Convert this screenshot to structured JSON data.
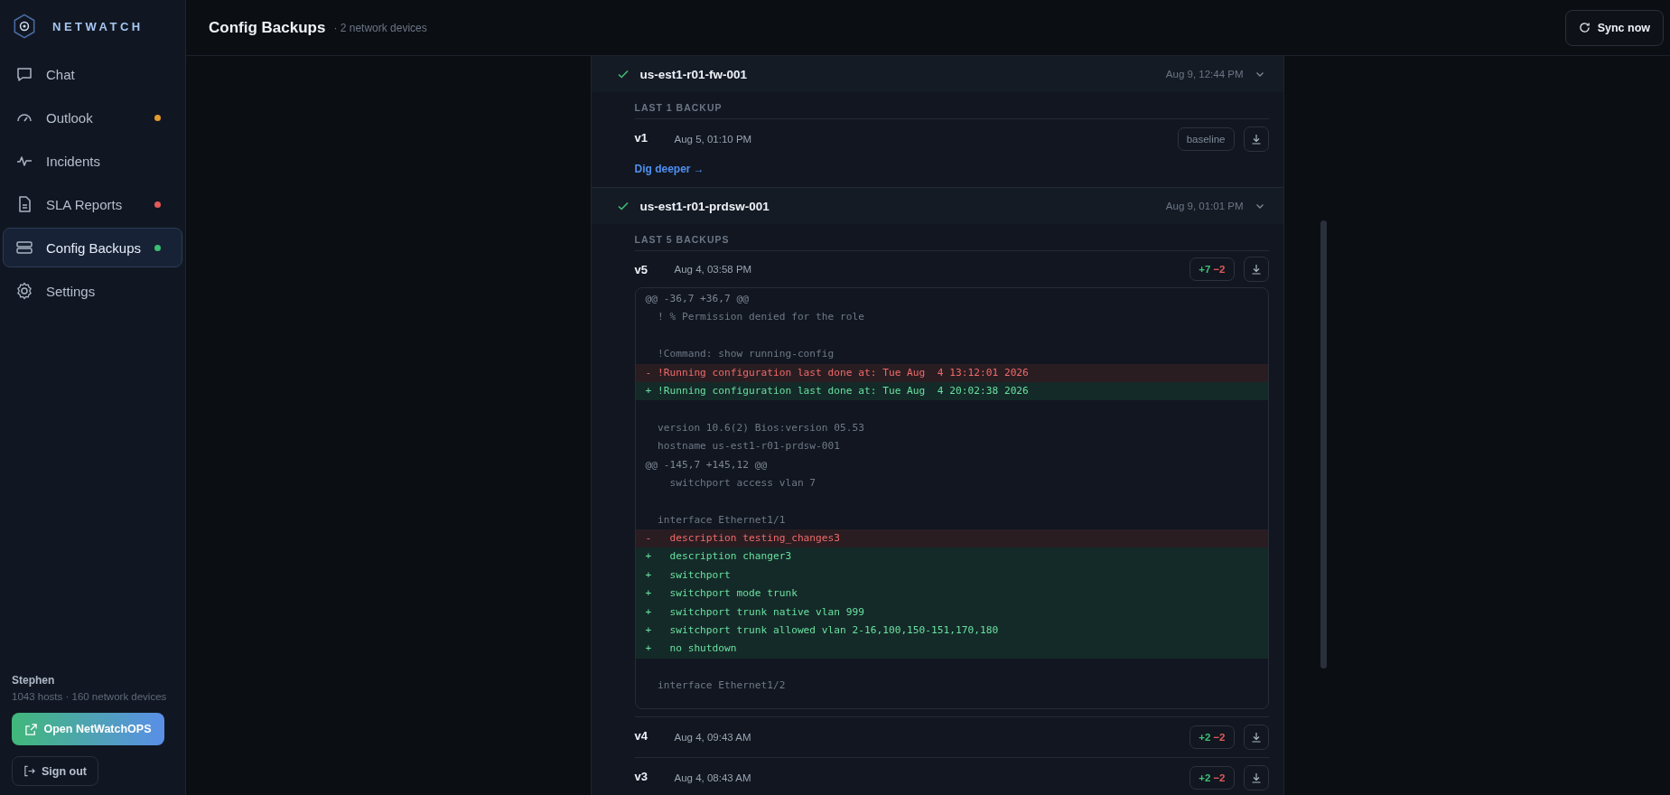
{
  "brand": {
    "name": "NETWATCH"
  },
  "nav": {
    "items": [
      {
        "label": "Chat",
        "selected": false
      },
      {
        "label": "Outlook",
        "selected": false,
        "color": "#e39b2f"
      },
      {
        "label": "Incidents",
        "selected": false
      },
      {
        "label": "SLA Reports",
        "selected": false,
        "color": "#e35a5a"
      },
      {
        "label": "Config Backups",
        "selected": true,
        "color": "#3bbf73"
      },
      {
        "label": "Settings",
        "selected": false
      }
    ]
  },
  "user": {
    "name": "Stephen",
    "summary": "1043 hosts · 160 network devices",
    "open_button": "Open NetWatchOPS",
    "signout_button": "Sign out"
  },
  "header": {
    "title": "Config Backups",
    "subtitle": "· 2 network devices",
    "sync_button": "Sync now"
  },
  "devices": [
    {
      "name": "us-est1-r01-fw-001",
      "time": "Aug 9, 12:44 PM",
      "expanded": true,
      "section": "LAST 1 BACKUP",
      "link": "Dig deeper →",
      "versions": [
        {
          "label": "v1",
          "time": "Aug 5, 01:10 PM",
          "badge": {
            "kind": "baseline",
            "label": "baseline"
          }
        }
      ]
    },
    {
      "name": "us-est1-r01-prdsw-001",
      "time": "Aug 9, 01:01 PM",
      "expanded": true,
      "section": "LAST 5 BACKUPS",
      "versions": [
        {
          "label": "v5",
          "time": "Aug 4, 03:58 PM",
          "badge": {
            "kind": "diff",
            "added": "+7",
            "removed": "−2"
          },
          "diff": [
            {
              "kind": "hunk",
              "text": "@@ -36,7 +36,7 @@"
            },
            {
              "kind": "context",
              "text": "  ! % Permission denied for the role"
            },
            {
              "kind": "blank"
            },
            {
              "kind": "context",
              "text": "  !Command: show running-config"
            },
            {
              "kind": "del",
              "text": "- !Running configuration last done at: Tue Aug  4 13:12:01 2026"
            },
            {
              "kind": "add",
              "text": "+ !Running configuration last done at: Tue Aug  4 20:02:38 2026"
            },
            {
              "kind": "blank"
            },
            {
              "kind": "context",
              "text": "  version 10.6(2) Bios:version 05.53"
            },
            {
              "kind": "context",
              "text": "  hostname us-est1-r01-prdsw-001"
            },
            {
              "kind": "hunk",
              "text": "@@ -145,7 +145,12 @@"
            },
            {
              "kind": "context",
              "text": "    switchport access vlan 7"
            },
            {
              "kind": "blank"
            },
            {
              "kind": "context",
              "text": "  interface Ethernet1/1"
            },
            {
              "kind": "del",
              "text": "-   description testing_changes3"
            },
            {
              "kind": "add",
              "text": "+   description changer3"
            },
            {
              "kind": "add",
              "text": "+   switchport"
            },
            {
              "kind": "add",
              "text": "+   switchport mode trunk"
            },
            {
              "kind": "add",
              "text": "+   switchport trunk native vlan 999"
            },
            {
              "kind": "add",
              "text": "+   switchport trunk allowed vlan 2-16,100,150-151,170,180"
            },
            {
              "kind": "add",
              "text": "+   no shutdown"
            },
            {
              "kind": "blank"
            },
            {
              "kind": "context",
              "text": "  interface Ethernet1/2"
            }
          ]
        },
        {
          "label": "v4",
          "time": "Aug 4, 09:43 AM",
          "badge": {
            "kind": "diff",
            "added": "+2",
            "removed": "−2"
          }
        },
        {
          "label": "v3",
          "time": "Aug 4, 08:43 AM",
          "badge": {
            "kind": "diff",
            "added": "+2",
            "removed": "−2"
          }
        }
      ]
    }
  ]
}
